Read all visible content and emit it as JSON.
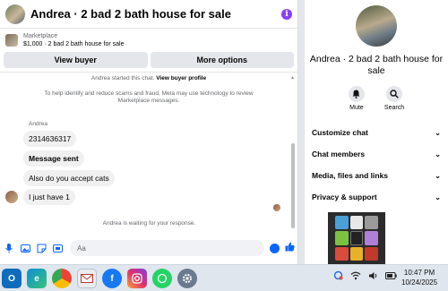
{
  "chat": {
    "title": "Andrea · 2 bad 2 bath house for sale",
    "info_icon": "i",
    "marketplace": {
      "kicker": "Marketplace",
      "listing": "$1,000 · 2 bad 2 bath house for sale"
    },
    "buttons": {
      "view_buyer": "View buyer",
      "more_options": "More options"
    },
    "system": {
      "started_prefix": "Andrea started this chat.",
      "view_buyer_profile": "View buyer profile",
      "notice": "To help identify and reduce scams and fraud, Meta may use technology to review Marketplace messages."
    },
    "messages": {
      "sender": "Andrea",
      "m1": "2314636317",
      "m2": "Message sent",
      "m3": "Also do you accept cats",
      "m4": "I just have 1"
    },
    "waiting": "Andrea is waiting for your response.",
    "composer_placeholder": "Aa"
  },
  "details": {
    "title": "Andrea · 2 bad 2 bath house for sale",
    "actions": {
      "mute": "Mute",
      "search": "Search"
    },
    "menu": [
      "Customize chat",
      "Chat members",
      "Media, files and links",
      "Privacy & support"
    ]
  },
  "taskbar": {
    "time": "10:47 PM",
    "date": "10/24/2025",
    "apps": [
      "outlook-icon",
      "edge-icon",
      "chrome-icon",
      "mail-icon",
      "facebook-icon",
      "instagram-icon",
      "whatsapp-icon",
      "settings-icon"
    ]
  }
}
